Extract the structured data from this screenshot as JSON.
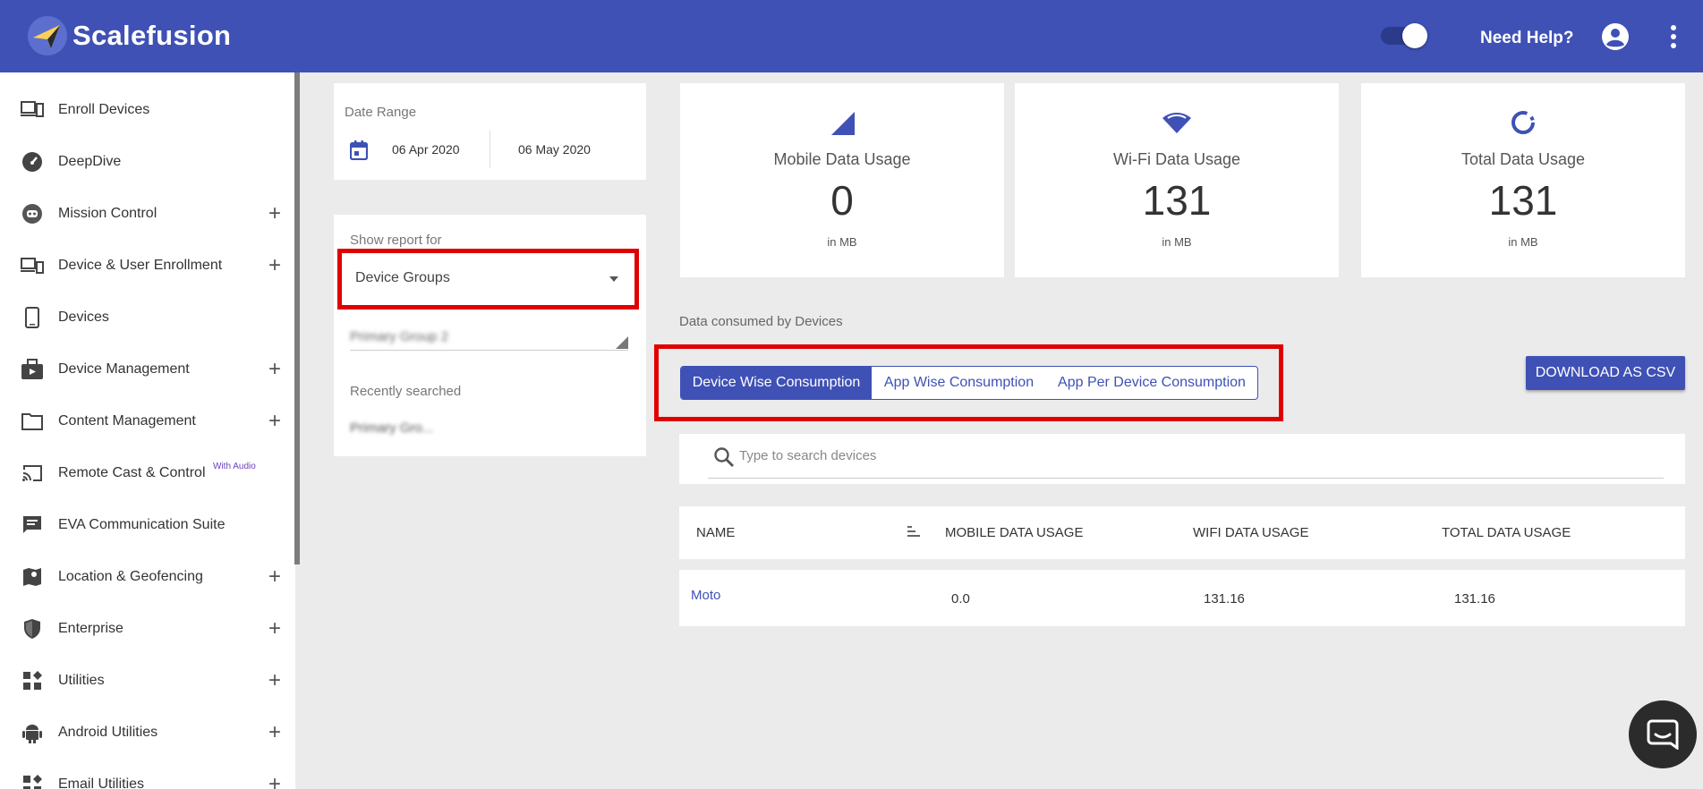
{
  "app": {
    "name": "Scalefusion",
    "help": "Need Help?"
  },
  "colors": {
    "primary": "#3f51b5",
    "highlight": "#e00000"
  },
  "sidebar": {
    "items": [
      {
        "label": "Enroll Devices",
        "icon": "enroll-icon",
        "expandable": false
      },
      {
        "label": "DeepDive",
        "icon": "speedometer-icon",
        "expandable": false
      },
      {
        "label": "Mission Control",
        "icon": "robot-icon",
        "expandable": true
      },
      {
        "label": "Device & User Enrollment",
        "icon": "devices-icon",
        "expandable": true
      },
      {
        "label": "Devices",
        "icon": "phone-icon",
        "expandable": false
      },
      {
        "label": "Device Management",
        "icon": "briefcase-icon",
        "expandable": true
      },
      {
        "label": "Content Management",
        "icon": "folder-icon",
        "expandable": true
      },
      {
        "label": "Remote Cast & Control",
        "sup": "With Audio",
        "icon": "cast-icon",
        "expandable": false
      },
      {
        "label": "EVA Communication Suite",
        "icon": "chat-icon",
        "expandable": false
      },
      {
        "label": "Location & Geofencing",
        "icon": "map-icon",
        "expandable": true
      },
      {
        "label": "Enterprise",
        "icon": "shield-icon",
        "expandable": true
      },
      {
        "label": "Utilities",
        "icon": "widgets-icon",
        "expandable": true
      },
      {
        "label": "Android Utilities",
        "icon": "android-icon",
        "expandable": true
      },
      {
        "label": "Email Utilities",
        "icon": "email-icon",
        "expandable": true
      }
    ],
    "plus": "+"
  },
  "filters": {
    "date_range_label": "Date Range",
    "start_date": "06 Apr 2020",
    "end_date": "06 May 2020",
    "show_report_label": "Show report for",
    "report_for": "Device Groups",
    "group_value": "Primary Group 2",
    "recently_searched_label": "Recently searched",
    "recent_item": "Primary Gro..."
  },
  "stats": [
    {
      "title": "Mobile Data Usage",
      "value": "0",
      "unit": "in MB",
      "icon": "signal-icon"
    },
    {
      "title": "Wi-Fi Data Usage",
      "value": "131",
      "unit": "in MB",
      "icon": "wifi-icon"
    },
    {
      "title": "Total Data Usage",
      "value": "131",
      "unit": "in MB",
      "icon": "donut-icon"
    }
  ],
  "consumption": {
    "section_label": "Data consumed by Devices",
    "tabs": [
      "Device Wise Consumption",
      "App Wise Consumption",
      "App Per Device Consumption"
    ],
    "active_tab": 0,
    "download_label": "DOWNLOAD AS CSV",
    "search_placeholder": "Type to search devices"
  },
  "table": {
    "headers": [
      "NAME",
      "MOBILE DATA USAGE",
      "WIFI DATA USAGE",
      "TOTAL DATA USAGE"
    ],
    "rows": [
      {
        "name": "Moto",
        "mobile": "0.0",
        "wifi": "131.16",
        "total": "131.16"
      }
    ]
  }
}
